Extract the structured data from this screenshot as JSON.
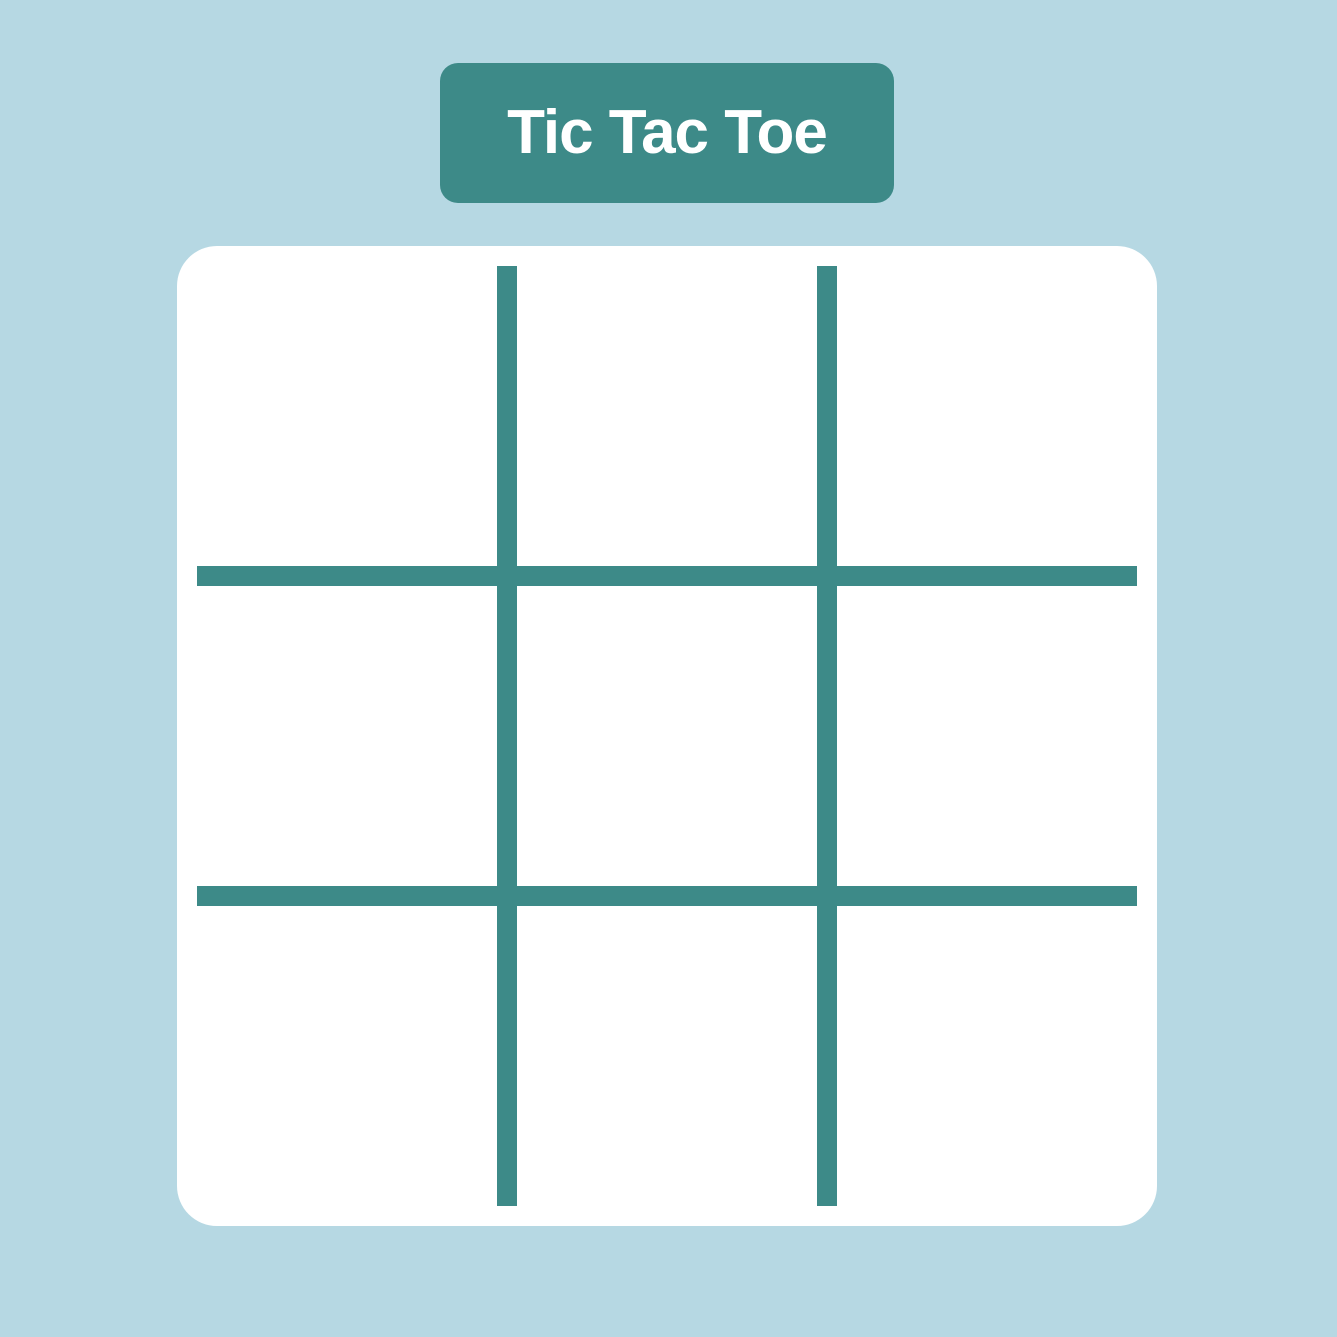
{
  "title": "Tic Tac Toe",
  "colors": {
    "background": "#b6d8e3",
    "accent": "#3d8a88",
    "board": "#ffffff",
    "title_text": "#ffffff"
  },
  "board": {
    "cells": [
      "",
      "",
      "",
      "",
      "",
      "",
      "",
      "",
      ""
    ]
  }
}
